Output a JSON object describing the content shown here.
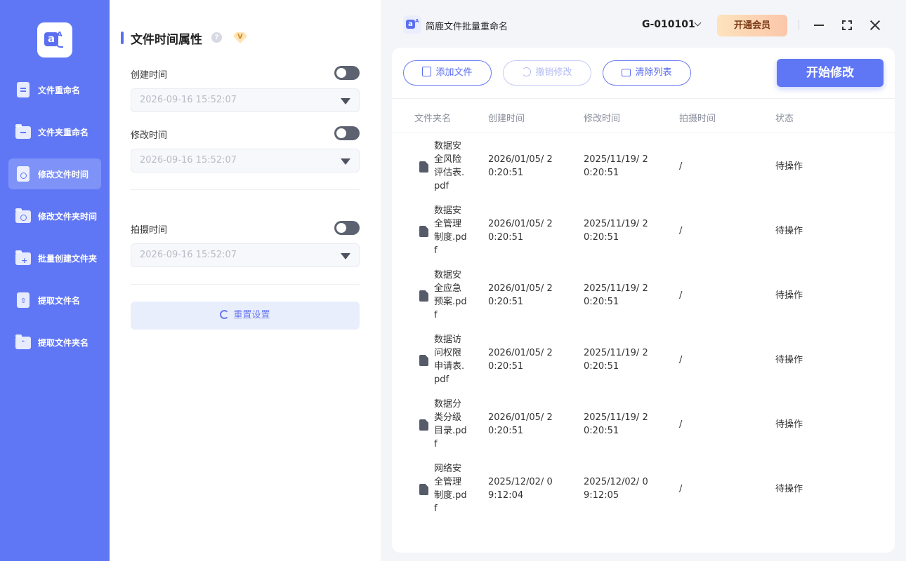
{
  "sidebar": {
    "items": [
      {
        "label": "文件重命名",
        "active": false,
        "icon": "file-rename-icon"
      },
      {
        "label": "文件夹重命名",
        "active": false,
        "icon": "folder-rename-icon"
      },
      {
        "label": "修改文件时间",
        "active": true,
        "icon": "file-time-icon"
      },
      {
        "label": "修改文件夹时间",
        "active": false,
        "icon": "folder-time-icon"
      },
      {
        "label": "批量创建文件夹",
        "active": false,
        "icon": "folder-add-icon"
      },
      {
        "label": "提取文件名",
        "active": false,
        "icon": "extract-filename-icon"
      },
      {
        "label": "提取文件夹名",
        "active": false,
        "icon": "extract-foldername-icon"
      }
    ]
  },
  "panel": {
    "title": "文件时间属性",
    "help_glyph": "?",
    "fields": {
      "created": {
        "label": "创建时间",
        "value": "2026-09-16 15:52:07",
        "enabled": false
      },
      "modified": {
        "label": "修改时间",
        "value": "2026-09-16 15:52:07",
        "enabled": false
      },
      "shot": {
        "label": "拍摄时间",
        "value": "2026-09-16 15:52:07",
        "enabled": false
      }
    },
    "reset_label": "重置设置"
  },
  "header": {
    "app_title": "简鹿文件批量重命名",
    "user_id": "G-010101",
    "vip_label": "开通会员"
  },
  "toolbar": {
    "add_label": "添加文件",
    "undo_label": "撤销修改",
    "clear_label": "清除列表",
    "start_label": "开始修改"
  },
  "table": {
    "headers": {
      "name": "文件夹名",
      "created": "创建时间",
      "modified": "修改时间",
      "shot": "拍摄时间",
      "status": "状态"
    },
    "rows": [
      {
        "name": "数据安全风险评估表.pdf",
        "created": "2026/01/05/ 20:20:51",
        "modified": "2025/11/19/ 20:20:51",
        "shot": "/",
        "status": "待操作"
      },
      {
        "name": "数据安全管理制度.pdf",
        "created": "2026/01/05/ 20:20:51",
        "modified": "2025/11/19/ 20:20:51",
        "shot": "/",
        "status": "待操作"
      },
      {
        "name": "数据安全应急预案.pdf",
        "created": "2026/01/05/ 20:20:51",
        "modified": "2025/11/19/ 20:20:51",
        "shot": "/",
        "status": "待操作"
      },
      {
        "name": "数据访问权限申请表.pdf",
        "created": "2026/01/05/ 20:20:51",
        "modified": "2025/11/19/ 20:20:51",
        "shot": "/",
        "status": "待操作"
      },
      {
        "name": "数据分类分级目录.pdf",
        "created": "2026/01/05/ 20:20:51",
        "modified": "2025/11/19/ 20:20:51",
        "shot": "/",
        "status": "待操作"
      },
      {
        "name": "网络安全管理制度.pdf",
        "created": "2025/12/02/ 09:12:04",
        "modified": "2025/12/02/ 09:12:05",
        "shot": "/",
        "status": "待操作"
      }
    ]
  },
  "colors": {
    "accent": "#6077f5",
    "sidebar_bg": "#6077f5",
    "vip_start": "#fde3bd",
    "vip_end": "#fbc6a9"
  }
}
